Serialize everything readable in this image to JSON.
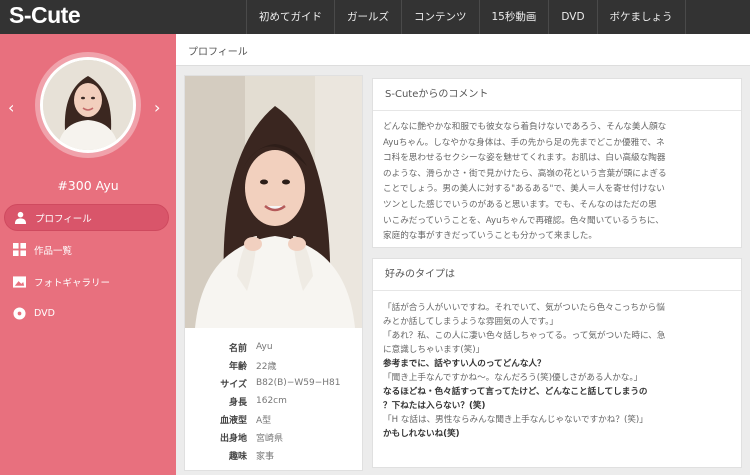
{
  "header": {
    "logo": "S-Cute",
    "nav": [
      "初めてガイド",
      "ガールズ",
      "コンテンツ",
      "15秒動画",
      "DVD",
      "ボケましょう"
    ]
  },
  "sidebar": {
    "prev_arrow": "‹",
    "next_arrow": "›",
    "profile_id": "#300 Ayu",
    "menu": [
      {
        "label": "プロフィール",
        "icon": "person-icon",
        "active": true
      },
      {
        "label": "作品一覧",
        "icon": "grid-icon",
        "active": false
      },
      {
        "label": "フォトギャラリー",
        "icon": "photo-icon",
        "active": false
      },
      {
        "label": "DVD",
        "icon": "disc-icon",
        "active": false
      }
    ]
  },
  "main": {
    "title": "プロフィール"
  },
  "profile": {
    "rows": [
      {
        "label": "名前",
        "value": "Ayu"
      },
      {
        "label": "年齢",
        "value": "22歳"
      },
      {
        "label": "サイズ",
        "value": "B82(B)−W59−H81"
      },
      {
        "label": "身長",
        "value": "162cm"
      },
      {
        "label": "血液型",
        "value": "A型"
      },
      {
        "label": "出身地",
        "value": "宮崎県"
      },
      {
        "label": "趣味",
        "value": "家事"
      }
    ]
  },
  "comment": {
    "title": "S-Cuteからのコメント",
    "lines": [
      "どんなに艶やかな和服でも彼女なら着負けないであろう、そんな美人顔な",
      "Ayuちゃん。しなやかな身体は、手の先から足の先までどこか優雅で、ネ",
      "コ科を思わせるセクシーな姿を魅せてくれます。お肌は、白い高級な陶器",
      "のような、滑らかさ・街で見かけたら、高嶺の花という言葉が頭によぎる",
      "ことでしょう。男の美人に対する\"あるある\"で、美人＝人を寄せ付けない",
      "ツンとした感じでいうのがあると思います。でも、そんなのはただの思",
      "いこみだっていうことを、Ayuちゃんで再確認。色々聞いているうちに、",
      "家庭的な事がすきだっていうことも分かって来ました。"
    ]
  },
  "types": {
    "title": "好みのタイプは",
    "lines": [
      {
        "text": "「話が合う人がいいですね。それでいて、気がついたら色々こっちから悩",
        "bold": false
      },
      {
        "text": "みとか話してしまうような雰囲気の人です。」",
        "bold": false
      },
      {
        "text": "「あれ？私、この人に凄い色々話しちゃってる。って気がついた時に、急",
        "bold": false
      },
      {
        "text": "に意識しちゃいます(笑)」",
        "bold": false
      },
      {
        "text": "参考までに、話やすい人のってどんな人？",
        "bold": true
      },
      {
        "text": "「聞き上手なんですかね〜。なんだろう(笑)優しさがある人かな。」",
        "bold": false
      },
      {
        "text": "なるほどね・色々話すって言ってたけど、どんなこと話してしまうの",
        "bold": true
      },
      {
        "text": "？下ねたは入らない？(笑)",
        "bold": true
      },
      {
        "text": "「H な話は、男性ならみんな聞き上手なんじゃないですかね？(笑)」",
        "bold": false
      },
      {
        "text": "かもしれないね(笑)",
        "bold": true
      }
    ]
  },
  "colors": {
    "topbar": "#333333",
    "sidebar": "#e8707e",
    "active_menu": "#d9556a"
  }
}
